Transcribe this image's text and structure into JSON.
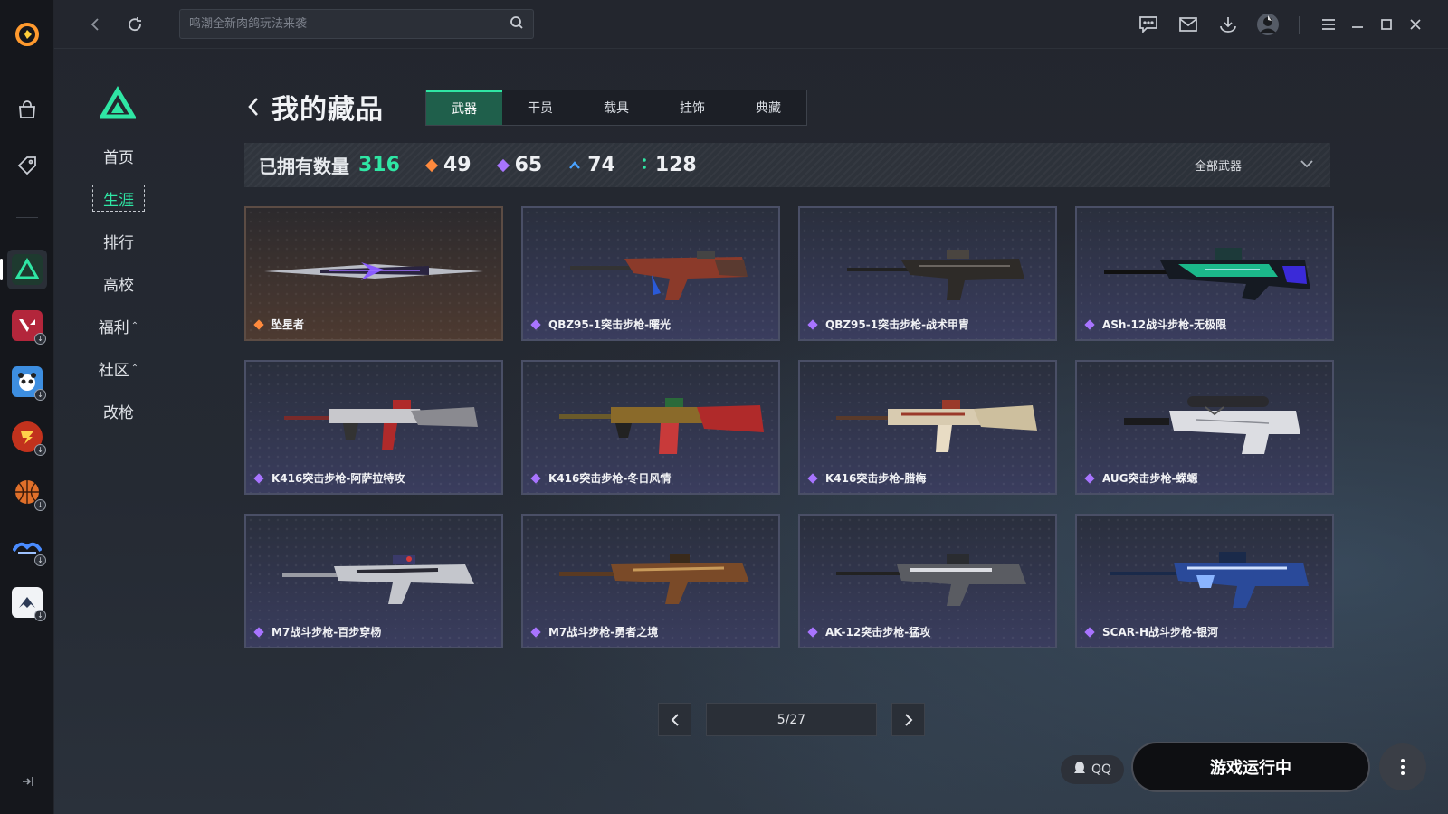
{
  "topbar": {
    "search_placeholder": "鸣潮全新肉鸽玩法来袭",
    "icons": [
      "back-icon",
      "refresh-icon",
      "search-icon",
      "chat-icon",
      "mail-icon",
      "download-icon",
      "avatar",
      "menu-icon",
      "minimize-icon",
      "maximize-icon",
      "close-icon"
    ]
  },
  "rail": {
    "items": [
      "app-logo",
      "store-icon",
      "tag-icon",
      "game-delta",
      "game-valorant",
      "game-panda",
      "game-crossfire",
      "game-basketball",
      "game-dnf",
      "game-warframe"
    ]
  },
  "subnav": {
    "items": [
      {
        "label": "首页"
      },
      {
        "label": "生涯",
        "active": true
      },
      {
        "label": "排行"
      },
      {
        "label": "高校"
      },
      {
        "label": "福利",
        "caret": "⌃"
      },
      {
        "label": "社区",
        "caret": "⌃"
      },
      {
        "label": "改枪"
      }
    ]
  },
  "header": {
    "title": "我的藏品",
    "tabs": [
      {
        "label": "武器",
        "active": true
      },
      {
        "label": "干员"
      },
      {
        "label": "载具"
      },
      {
        "label": "挂饰"
      },
      {
        "label": "典藏"
      }
    ]
  },
  "stats": {
    "owned_label": "已拥有数量",
    "owned_total": "316",
    "rarities": [
      {
        "value": "49",
        "color": "#ff8a3d"
      },
      {
        "value": "65",
        "color": "#a874ff"
      },
      {
        "value": "74",
        "color": "#4aa3ff"
      },
      {
        "value": "128",
        "color": "#2fe6a4"
      }
    ],
    "filter_label": "全部武器"
  },
  "items": [
    {
      "name": "坠星者",
      "rarity": "gold",
      "art": "blade"
    },
    {
      "name": "QBZ95-1突击步枪-曙光",
      "rarity": "purple",
      "art": "bullpup-red"
    },
    {
      "name": "QBZ95-1突击步枪-战术甲胄",
      "rarity": "purple",
      "art": "bullpup-dark"
    },
    {
      "name": "ASh-12战斗步枪-无极限",
      "rarity": "purple",
      "art": "ash-green"
    },
    {
      "name": "K416突击步枪-阿萨拉特攻",
      "rarity": "purple",
      "art": "rifle-redsilver"
    },
    {
      "name": "K416突击步枪-冬日风情",
      "rarity": "purple",
      "art": "rifle-xmas"
    },
    {
      "name": "K416突击步枪-腊梅",
      "rarity": "purple",
      "art": "rifle-cream"
    },
    {
      "name": "AUG突击步枪-蝾螈",
      "rarity": "purple",
      "art": "aug-white"
    },
    {
      "name": "M7战斗步枪-百步穿杨",
      "rarity": "purple",
      "art": "m7-silver"
    },
    {
      "name": "M7战斗步枪-勇者之境",
      "rarity": "purple",
      "art": "m7-bronze"
    },
    {
      "name": "AK-12突击步枪-猛攻",
      "rarity": "purple",
      "art": "ak-grey"
    },
    {
      "name": "SCAR-H战斗步枪-银河",
      "rarity": "purple",
      "art": "scar-blue"
    }
  ],
  "pagination": {
    "label": "5/27"
  },
  "bottom": {
    "qq_label": "QQ",
    "run_label": "游戏运行中"
  }
}
